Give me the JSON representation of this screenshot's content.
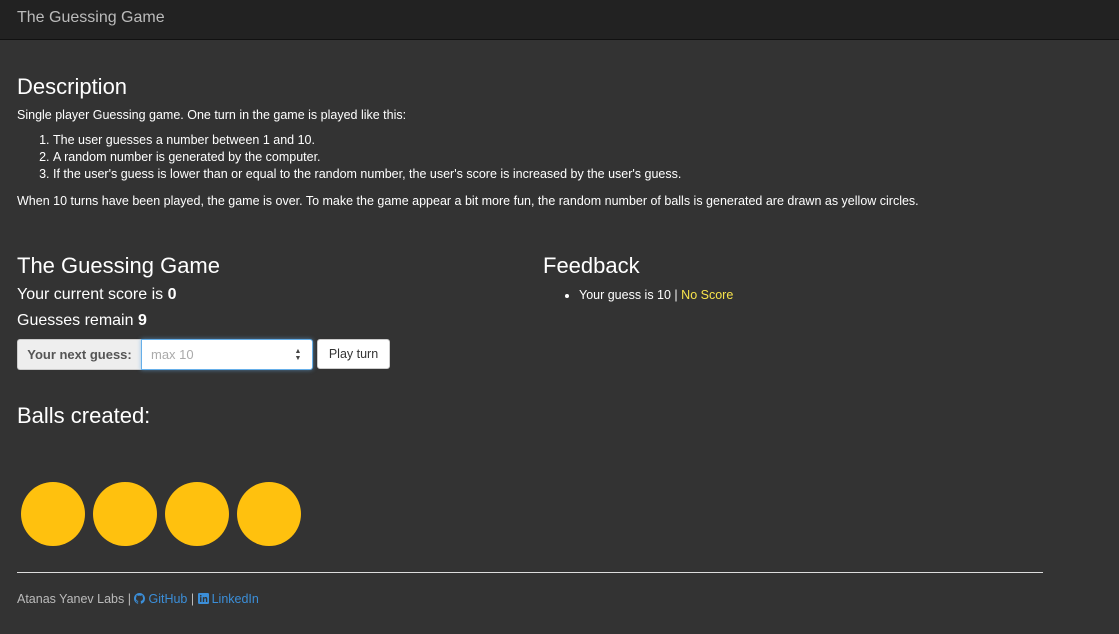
{
  "app": {
    "title": "The Guessing Game"
  },
  "description": {
    "heading": "Description",
    "intro": "Single player Guessing game. One turn in the game is played like this:",
    "steps": [
      "The user guesses a number between 1 and 10.",
      "A random number is generated by the computer.",
      "If the user's guess is lower than or equal to the random number, the user's score is increased by the user's guess."
    ],
    "outro": "When 10 turns have been played, the game is over. To make the game appear a bit more fun, the random number of balls is generated are drawn as yellow circles."
  },
  "game": {
    "heading": "The Guessing Game",
    "score_label": "Your current score is",
    "score_value": "0",
    "remain_label": "Guesses remain",
    "remain_value": "9",
    "guess_addon": "Your next guess:",
    "guess_value": "",
    "guess_placeholder": "max 10",
    "play_button": "Play turn"
  },
  "feedback": {
    "heading": "Feedback",
    "items": [
      {
        "text": "Your guess is 10 |",
        "result": "No Score"
      }
    ]
  },
  "balls": {
    "heading": "Balls created:",
    "count": 4,
    "color": "#ffc10e"
  },
  "footer": {
    "owner": "Atanas Yanev Labs |",
    "separator": "|",
    "github": {
      "label": "GitHub",
      "icon": "github-icon"
    },
    "linkedin": {
      "label": "LinkedIn",
      "icon": "linkedin-icon"
    },
    "link_color": "#3b8ed8"
  },
  "colors": {
    "background": "#333333",
    "navbar": "#222222",
    "no_score": "#f7e34b"
  }
}
